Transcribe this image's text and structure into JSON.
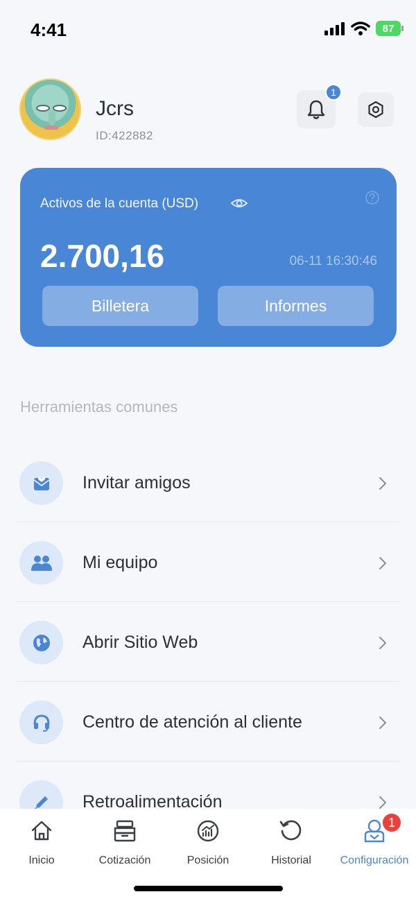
{
  "status_bar": {
    "time": "4:41",
    "battery": "87"
  },
  "profile": {
    "name": "Jcrs",
    "id": "ID:422882",
    "notification_count": "1"
  },
  "account_card": {
    "label": "Activos de la cuenta (USD)",
    "balance": "2.700,16",
    "timestamp": "06-11 16:30:46",
    "wallet_label": "Billetera",
    "reports_label": "Informes"
  },
  "section_title": "Herramientas comunes",
  "tools": [
    {
      "label": "Invitar amigos",
      "icon": "invite-icon"
    },
    {
      "label": "Mi equipo",
      "icon": "team-icon"
    },
    {
      "label": "Abrir Sitio Web",
      "icon": "globe-icon"
    },
    {
      "label": "Centro de atención al cliente",
      "icon": "headset-icon"
    },
    {
      "label": "Retroalimentación",
      "icon": "pencil-icon"
    }
  ],
  "tabs": [
    {
      "label": "Inicio",
      "icon": "home-icon"
    },
    {
      "label": "Cotización",
      "icon": "quote-icon"
    },
    {
      "label": "Posición",
      "icon": "position-icon"
    },
    {
      "label": "Historial",
      "icon": "history-icon"
    },
    {
      "label": "Configuración",
      "icon": "profile-icon",
      "active": true,
      "badge": "1"
    }
  ],
  "colors": {
    "accent": "#4a86d6",
    "badge_red": "#e9423a",
    "background": "#f6f7fb"
  }
}
